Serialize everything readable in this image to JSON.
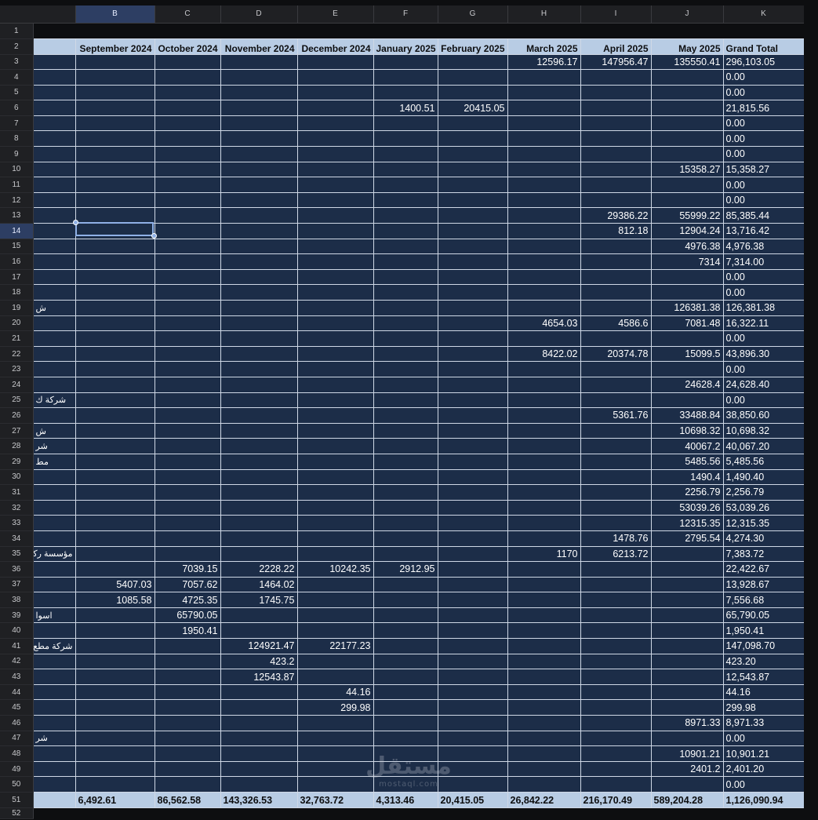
{
  "columns": [
    "B",
    "C",
    "D",
    "E",
    "F",
    "G",
    "H",
    "I",
    "J",
    "K"
  ],
  "selected_column": "B",
  "selected_row": 14,
  "header_row": [
    "September 2024",
    "October 2024",
    "November 2024",
    "December 2024",
    "January 2025",
    "February 2025",
    "March 2025",
    "April 2025",
    "May 2025",
    "Grand Total"
  ],
  "rows": [
    {
      "n": "3",
      "a": "",
      "v": [
        "",
        "",
        "",
        "",
        "",
        "",
        "12596.17",
        "147956.47",
        "135550.41",
        "296,103.05"
      ]
    },
    {
      "n": "4",
      "a": "",
      "v": [
        "",
        "",
        "",
        "",
        "",
        "",
        "",
        "",
        "",
        "0.00"
      ]
    },
    {
      "n": "5",
      "a": "",
      "v": [
        "",
        "",
        "",
        "",
        "",
        "",
        "",
        "",
        "",
        "0.00"
      ]
    },
    {
      "n": "6",
      "a": "",
      "v": [
        "",
        "",
        "",
        "",
        "1400.51",
        "20415.05",
        "",
        "",
        "",
        "21,815.56"
      ]
    },
    {
      "n": "7",
      "a": "",
      "v": [
        "",
        "",
        "",
        "",
        "",
        "",
        "",
        "",
        "",
        "0.00"
      ]
    },
    {
      "n": "8",
      "a": "",
      "v": [
        "",
        "",
        "",
        "",
        "",
        "",
        "",
        "",
        "",
        "0.00"
      ]
    },
    {
      "n": "9",
      "a": "",
      "v": [
        "",
        "",
        "",
        "",
        "",
        "",
        "",
        "",
        "",
        "0.00"
      ]
    },
    {
      "n": "10",
      "a": "",
      "v": [
        "",
        "",
        "",
        "",
        "",
        "",
        "",
        "",
        "15358.27",
        "15,358.27"
      ]
    },
    {
      "n": "11",
      "a": "",
      "v": [
        "",
        "",
        "",
        "",
        "",
        "",
        "",
        "",
        "",
        "0.00"
      ]
    },
    {
      "n": "12",
      "a": "",
      "v": [
        "",
        "",
        "",
        "",
        "",
        "",
        "",
        "",
        "",
        "0.00"
      ]
    },
    {
      "n": "13",
      "a": "",
      "v": [
        "",
        "",
        "",
        "",
        "",
        "",
        "",
        "29386.22",
        "55999.22",
        "85,385.44"
      ]
    },
    {
      "n": "14",
      "a": "",
      "v": [
        "",
        "",
        "",
        "",
        "",
        "",
        "",
        "812.18",
        "12904.24",
        "13,716.42"
      ]
    },
    {
      "n": "15",
      "a": "",
      "v": [
        "",
        "",
        "",
        "",
        "",
        "",
        "",
        "",
        "4976.38",
        "4,976.38"
      ]
    },
    {
      "n": "16",
      "a": "",
      "v": [
        "",
        "",
        "",
        "",
        "",
        "",
        "",
        "",
        "7314",
        "7,314.00"
      ]
    },
    {
      "n": "17",
      "a": "",
      "v": [
        "",
        "",
        "",
        "",
        "",
        "",
        "",
        "",
        "",
        "0.00"
      ]
    },
    {
      "n": "18",
      "a": "",
      "v": [
        "",
        "",
        "",
        "",
        "",
        "",
        "",
        "",
        "",
        "0.00"
      ]
    },
    {
      "n": "19",
      "a": "ش",
      "v": [
        "",
        "",
        "",
        "",
        "",
        "",
        "",
        "",
        "126381.38",
        "126,381.38"
      ]
    },
    {
      "n": "20",
      "a": "",
      "v": [
        "",
        "",
        "",
        "",
        "",
        "",
        "4654.03",
        "4586.6",
        "7081.48",
        "16,322.11"
      ]
    },
    {
      "n": "21",
      "a": "",
      "v": [
        "",
        "",
        "",
        "",
        "",
        "",
        "",
        "",
        "",
        "0.00"
      ]
    },
    {
      "n": "22",
      "a": "",
      "v": [
        "",
        "",
        "",
        "",
        "",
        "",
        "8422.02",
        "20374.78",
        "15099.5",
        "43,896.30"
      ]
    },
    {
      "n": "23",
      "a": "",
      "v": [
        "",
        "",
        "",
        "",
        "",
        "",
        "",
        "",
        "",
        "0.00"
      ]
    },
    {
      "n": "24",
      "a": "",
      "v": [
        "",
        "",
        "",
        "",
        "",
        "",
        "",
        "",
        "24628.4",
        "24,628.40"
      ]
    },
    {
      "n": "25",
      "a": "شركة ك",
      "v": [
        "",
        "",
        "",
        "",
        "",
        "",
        "",
        "",
        "",
        "0.00"
      ]
    },
    {
      "n": "26",
      "a": "",
      "v": [
        "",
        "",
        "",
        "",
        "",
        "",
        "",
        "5361.76",
        "33488.84",
        "38,850.60"
      ]
    },
    {
      "n": "27",
      "a": "ش",
      "v": [
        "",
        "",
        "",
        "",
        "",
        "",
        "",
        "",
        "10698.32",
        "10,698.32"
      ]
    },
    {
      "n": "28",
      "a": "شر",
      "v": [
        "",
        "",
        "",
        "",
        "",
        "",
        "",
        "",
        "40067.2",
        "40,067.20"
      ]
    },
    {
      "n": "29",
      "a": "مط",
      "v": [
        "",
        "",
        "",
        "",
        "",
        "",
        "",
        "",
        "5485.56",
        "5,485.56"
      ]
    },
    {
      "n": "30",
      "a": "",
      "v": [
        "",
        "",
        "",
        "",
        "",
        "",
        "",
        "",
        "1490.4",
        "1,490.40"
      ]
    },
    {
      "n": "31",
      "a": "",
      "v": [
        "",
        "",
        "",
        "",
        "",
        "",
        "",
        "",
        "2256.79",
        "2,256.79"
      ]
    },
    {
      "n": "32",
      "a": "",
      "v": [
        "",
        "",
        "",
        "",
        "",
        "",
        "",
        "",
        "53039.26",
        "53,039.26"
      ]
    },
    {
      "n": "33",
      "a": "",
      "v": [
        "",
        "",
        "",
        "",
        "",
        "",
        "",
        "",
        "12315.35",
        "12,315.35"
      ]
    },
    {
      "n": "34",
      "a": "",
      "v": [
        "",
        "",
        "",
        "",
        "",
        "",
        "",
        "1478.76",
        "2795.54",
        "4,274.30"
      ]
    },
    {
      "n": "35",
      "a": "مؤسسة ركن",
      "v": [
        "",
        "",
        "",
        "",
        "",
        "",
        "1170",
        "6213.72",
        "",
        "7,383.72"
      ]
    },
    {
      "n": "36",
      "a": "",
      "v": [
        "",
        "7039.15",
        "2228.22",
        "10242.35",
        "2912.95",
        "",
        "",
        "",
        "",
        "22,422.67"
      ]
    },
    {
      "n": "37",
      "a": "",
      "v": [
        "5407.03",
        "7057.62",
        "1464.02",
        "",
        "",
        "",
        "",
        "",
        "",
        "13,928.67"
      ]
    },
    {
      "n": "38",
      "a": "",
      "v": [
        "1085.58",
        "4725.35",
        "1745.75",
        "",
        "",
        "",
        "",
        "",
        "",
        "7,556.68"
      ]
    },
    {
      "n": "39",
      "a": "اسوا",
      "v": [
        "",
        "65790.05",
        "",
        "",
        "",
        "",
        "",
        "",
        "",
        "65,790.05"
      ]
    },
    {
      "n": "40",
      "a": "",
      "v": [
        "",
        "1950.41",
        "",
        "",
        "",
        "",
        "",
        "",
        "",
        "1,950.41"
      ]
    },
    {
      "n": "41",
      "a": "شركة مطع",
      "v": [
        "",
        "",
        "124921.47",
        "22177.23",
        "",
        "",
        "",
        "",
        "",
        "147,098.70"
      ]
    },
    {
      "n": "42",
      "a": "",
      "v": [
        "",
        "",
        "423.2",
        "",
        "",
        "",
        "",
        "",
        "",
        "423.20"
      ]
    },
    {
      "n": "43",
      "a": "",
      "v": [
        "",
        "",
        "12543.87",
        "",
        "",
        "",
        "",
        "",
        "",
        "12,543.87"
      ]
    },
    {
      "n": "44",
      "a": "",
      "v": [
        "",
        "",
        "",
        "44.16",
        "",
        "",
        "",
        "",
        "",
        "44.16"
      ]
    },
    {
      "n": "45",
      "a": "",
      "v": [
        "",
        "",
        "",
        "299.98",
        "",
        "",
        "",
        "",
        "",
        "299.98"
      ]
    },
    {
      "n": "46",
      "a": "",
      "v": [
        "",
        "",
        "",
        "",
        "",
        "",
        "",
        "",
        "8971.33",
        "8,971.33"
      ]
    },
    {
      "n": "47",
      "a": "شر",
      "v": [
        "",
        "",
        "",
        "",
        "",
        "",
        "",
        "",
        "",
        "0.00"
      ]
    },
    {
      "n": "48",
      "a": "",
      "v": [
        "",
        "",
        "",
        "",
        "",
        "",
        "",
        "",
        "10901.21",
        "10,901.21"
      ]
    },
    {
      "n": "49",
      "a": "",
      "v": [
        "",
        "",
        "",
        "",
        "",
        "",
        "",
        "",
        "2401.2",
        "2,401.20"
      ]
    },
    {
      "n": "50",
      "a": "",
      "v": [
        "",
        "",
        "",
        "",
        "",
        "",
        "",
        "",
        "",
        "0.00"
      ]
    }
  ],
  "totals_row": {
    "n": "51",
    "v": [
      "6,492.61",
      "86,562.58",
      "143,326.53",
      "32,763.72",
      "4,313.46",
      "20,415.05",
      "26,842.22",
      "216,170.49",
      "589,204.28",
      "1,126,090.94"
    ]
  },
  "watermark": {
    "arabic": "مستقل",
    "latin": "mostaql.com"
  }
}
